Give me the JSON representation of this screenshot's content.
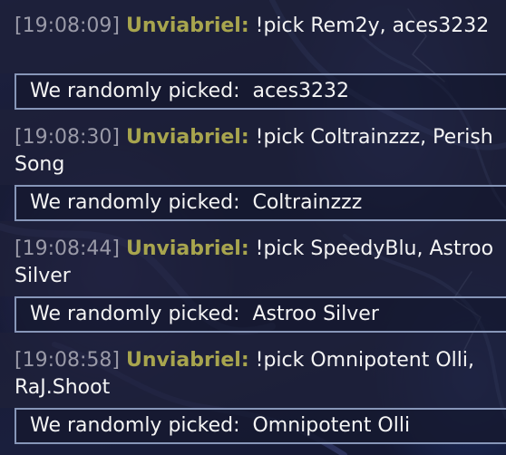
{
  "chat": {
    "messages": [
      {
        "timestamp": "[19:08:09]",
        "user": "Unviabriel:",
        "text": "!pick Rem2y, aces3232",
        "result_label": "We randomly picked:",
        "result_value": "aces3232"
      },
      {
        "timestamp": "[19:08:30]",
        "user": "Unviabriel:",
        "text": "!pick Coltrainzzz, Perish Song",
        "result_label": "We randomly picked:",
        "result_value": "Coltrainzzz"
      },
      {
        "timestamp": "[19:08:44]",
        "user": "Unviabriel:",
        "text": "!pick SpeedyBlu, Astroo Silver",
        "result_label": "We randomly picked:",
        "result_value": "Astroo Silver"
      },
      {
        "timestamp": "[19:08:58]",
        "user": "Unviabriel:",
        "text": "!pick Omnipotent Olli, RaJ.Shoot",
        "result_label": "We randomly picked:",
        "result_value": "Omnipotent Olli"
      }
    ]
  },
  "colors": {
    "timestamp": "#9a9aa8",
    "username": "#a8a54e",
    "result_border": "#8796b8",
    "background": "#1a1f3d"
  }
}
